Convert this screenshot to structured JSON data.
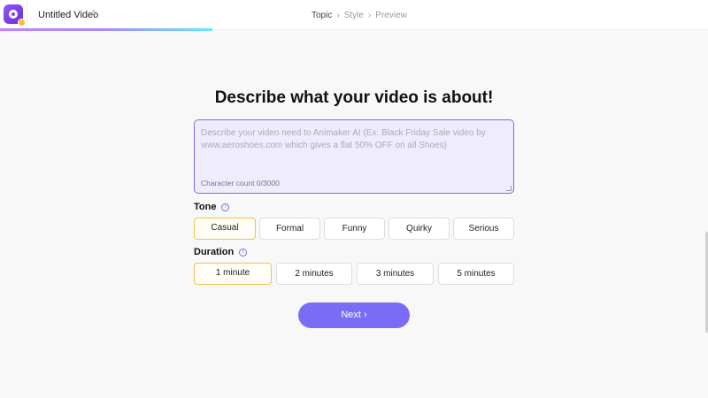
{
  "header": {
    "project_title": "Untitled Video",
    "steps": [
      "Topic",
      "Style",
      "Preview"
    ],
    "step_separator": "›",
    "active_step_index": 0,
    "progress_fraction": 0.3
  },
  "main": {
    "heading": "Describe what your video is about!",
    "description": {
      "placeholder": "Describe your video need to Animaker AI (Ex: Black Friday Sale video by www.aeroshoes.com which gives a flat 50% OFF on all Shoes)",
      "value": "",
      "char_count": "Character count 0/3000"
    },
    "tone": {
      "label": "Tone",
      "options": [
        "Casual",
        "Formal",
        "Funny",
        "Quirky",
        "Serious"
      ],
      "selected": "Casual"
    },
    "duration": {
      "label": "Duration",
      "options": [
        "1 minute",
        "2 minutes",
        "3 minutes",
        "5 minutes"
      ],
      "selected": "1 minute"
    },
    "next_label": "Next ›"
  },
  "colors": {
    "accent": "#7b6cf6",
    "selected_border": "#f2c24e"
  },
  "icons": {
    "app_logo": "app-logo-icon",
    "rename": "pencil-icon",
    "info": "info-icon"
  }
}
